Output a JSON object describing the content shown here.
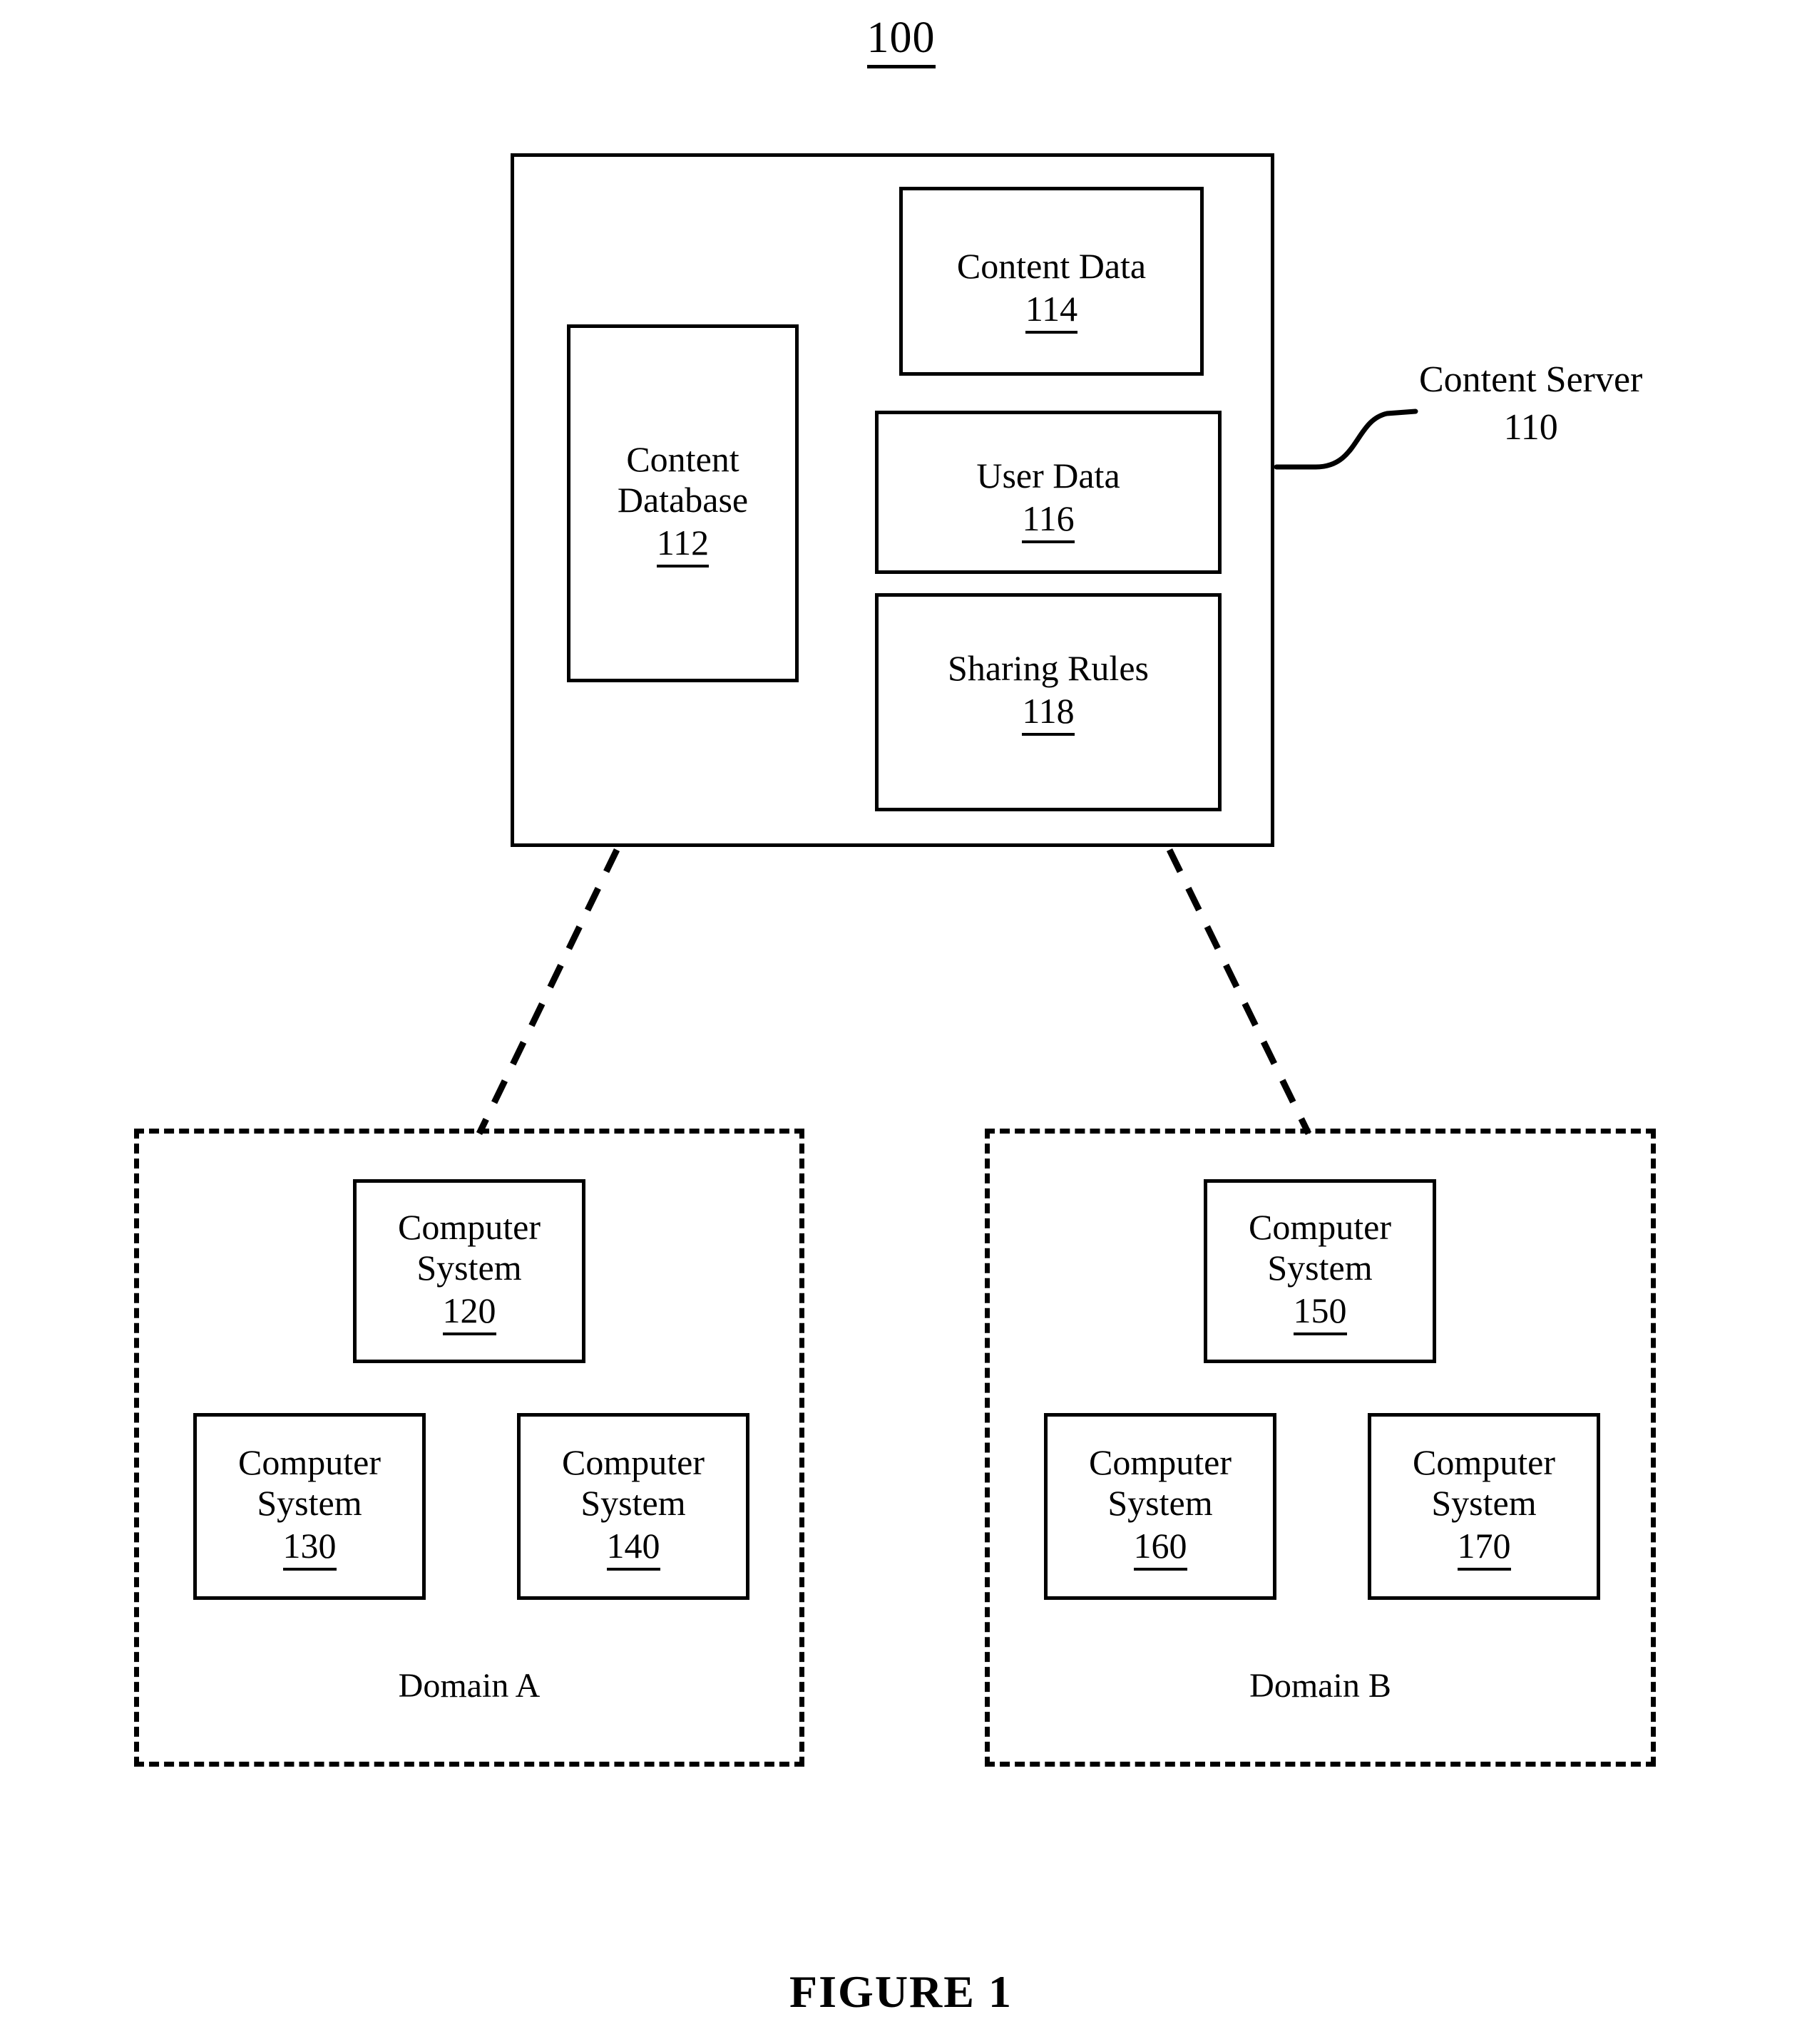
{
  "figure": {
    "number_label": "100",
    "caption": "FIGURE 1"
  },
  "content_server": {
    "leader_label_name": "Content Server",
    "leader_label_number": "110",
    "components": [
      {
        "key": "content_database",
        "label": "Content",
        "label2": "Database",
        "number": "112"
      },
      {
        "key": "content_data",
        "label": "Content Data",
        "label2": "",
        "number": "114"
      },
      {
        "key": "user_data",
        "label": "User Data",
        "label2": "",
        "number": "116"
      },
      {
        "key": "sharing_rules",
        "label": "Sharing Rules",
        "label2": "",
        "number": "118"
      }
    ]
  },
  "domains": [
    {
      "key": "domain_a",
      "label": "Domain A",
      "systems": [
        {
          "label": "Computer",
          "label2": "System",
          "number": "120"
        },
        {
          "label": "Computer",
          "label2": "System",
          "number": "130"
        },
        {
          "label": "Computer",
          "label2": "System",
          "number": "140"
        }
      ]
    },
    {
      "key": "domain_b",
      "label": "Domain B",
      "systems": [
        {
          "label": "Computer",
          "label2": "System",
          "number": "150"
        },
        {
          "label": "Computer",
          "label2": "System",
          "number": "160"
        },
        {
          "label": "Computer",
          "label2": "System",
          "number": "170"
        }
      ]
    }
  ],
  "colors": {
    "ink": "#000000",
    "paper": "#ffffff"
  }
}
